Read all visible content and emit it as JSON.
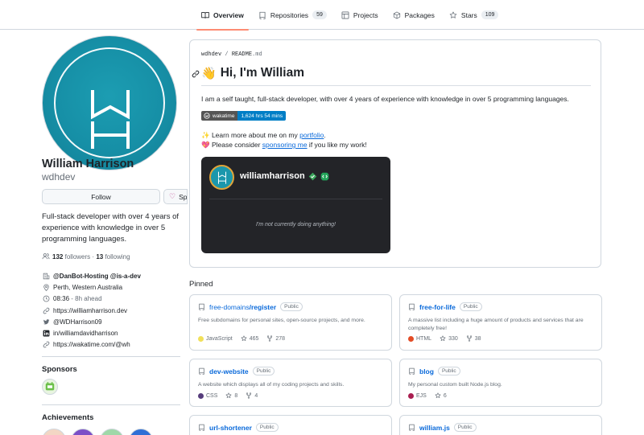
{
  "tabs": [
    {
      "label": "Overview",
      "icon": "book-icon"
    },
    {
      "label": "Repositories",
      "count": "59",
      "icon": "repo-icon"
    },
    {
      "label": "Projects",
      "icon": "table-icon"
    },
    {
      "label": "Packages",
      "icon": "package-icon"
    },
    {
      "label": "Stars",
      "count": "109",
      "icon": "star-icon"
    }
  ],
  "profile": {
    "full_name": "William Harrison",
    "username": "wdhdev",
    "follow_label": "Follow",
    "sponsor_label": "Sponsor",
    "bio": "Full-stack developer with over 4 years of experience with knowledge in over 5 programming languages.",
    "followers_count": "132",
    "followers_label": "followers",
    "separator": "·",
    "following_count": "13",
    "following_label": "following",
    "organization": "@DanBot-Hosting @is-a-dev",
    "location": "Perth, Western Australia",
    "local_time": "08:36",
    "time_offset": "- 8h ahead",
    "website": "https://williamharrison.dev",
    "twitter": "@WDHarrison09",
    "linkedin": "in/williamdavidharrison",
    "wakatime": "https://wakatime.com/@wh"
  },
  "sponsors": {
    "heading": "Sponsors"
  },
  "achievements": {
    "heading": "Achievements"
  },
  "readme": {
    "path_user": "wdhdev",
    "path_sep": " / ",
    "path_file": "README",
    "path_ext": ".md",
    "title_emoji": "👋",
    "title": "Hi, I'm William",
    "intro": "I am a self taught, full-stack developer, with over 4 years of experience with knowledge in over 5 programming languages.",
    "badge_label": "wakatime",
    "badge_value": "1,624 hrs 54 mins",
    "learn_prefix": "✨ Learn more about me on my ",
    "learn_link": "portfolio",
    "learn_suffix": ".",
    "sponsor_prefix": "💖 Please consider ",
    "sponsor_link": "sponsoring me",
    "sponsor_suffix": " if you like my work!",
    "discord_name": "williamharrison",
    "discord_status": "I'm not currently doing anything!"
  },
  "pinned": {
    "heading": "Pinned",
    "repos": [
      {
        "owner": "free-domains",
        "name": "register",
        "visibility": "Public",
        "description": "Free subdomains for personal sites, open-source projects, and more.",
        "language": "JavaScript",
        "lang_color": "#f1e05a",
        "stars": "465",
        "forks": "278"
      },
      {
        "owner": "",
        "name": "free-for-life",
        "visibility": "Public",
        "description": "A massive list including a huge amount of products and services that are completely free!",
        "language": "HTML",
        "lang_color": "#e34c26",
        "stars": "330",
        "forks": "38"
      },
      {
        "owner": "",
        "name": "dev-website",
        "visibility": "Public",
        "description": "A website which displays all of my coding projects and skills.",
        "language": "CSS",
        "lang_color": "#563d7c",
        "stars": "8",
        "forks": "4"
      },
      {
        "owner": "",
        "name": "blog",
        "visibility": "Public",
        "description": "My personal custom built Node.js blog.",
        "language": "EJS",
        "lang_color": "#a91e50",
        "stars": "6",
        "forks": ""
      },
      {
        "owner": "",
        "name": "url-shortener",
        "visibility": "Public",
        "description": "",
        "language": "",
        "lang_color": "",
        "stars": "",
        "forks": ""
      },
      {
        "owner": "",
        "name": "william.js",
        "visibility": "Public",
        "description": "",
        "language": "",
        "lang_color": "",
        "stars": "",
        "forks": ""
      }
    ]
  }
}
